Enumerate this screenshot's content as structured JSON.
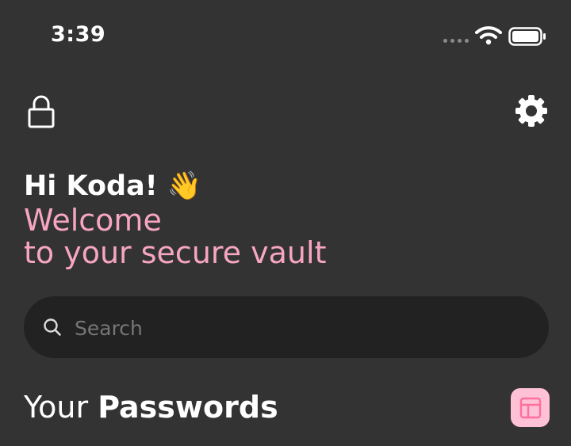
{
  "status_bar": {
    "time": "3:39"
  },
  "header": {
    "lock_icon": "lock-icon",
    "settings_icon": "gear-icon"
  },
  "greeting": {
    "hello": "Hi Koda! 👋",
    "welcome_line_1": "Welcome",
    "welcome_line_2": "to your secure vault"
  },
  "search": {
    "placeholder": "Search",
    "value": ""
  },
  "passwords_section": {
    "title_regular": "Your ",
    "title_bold": "Passwords",
    "layout_icon": "layout-icon"
  },
  "colors": {
    "background": "#333333",
    "accent_pink": "#f7a6c0",
    "button_pink": "#ffc1d5",
    "search_background": "#222222"
  }
}
